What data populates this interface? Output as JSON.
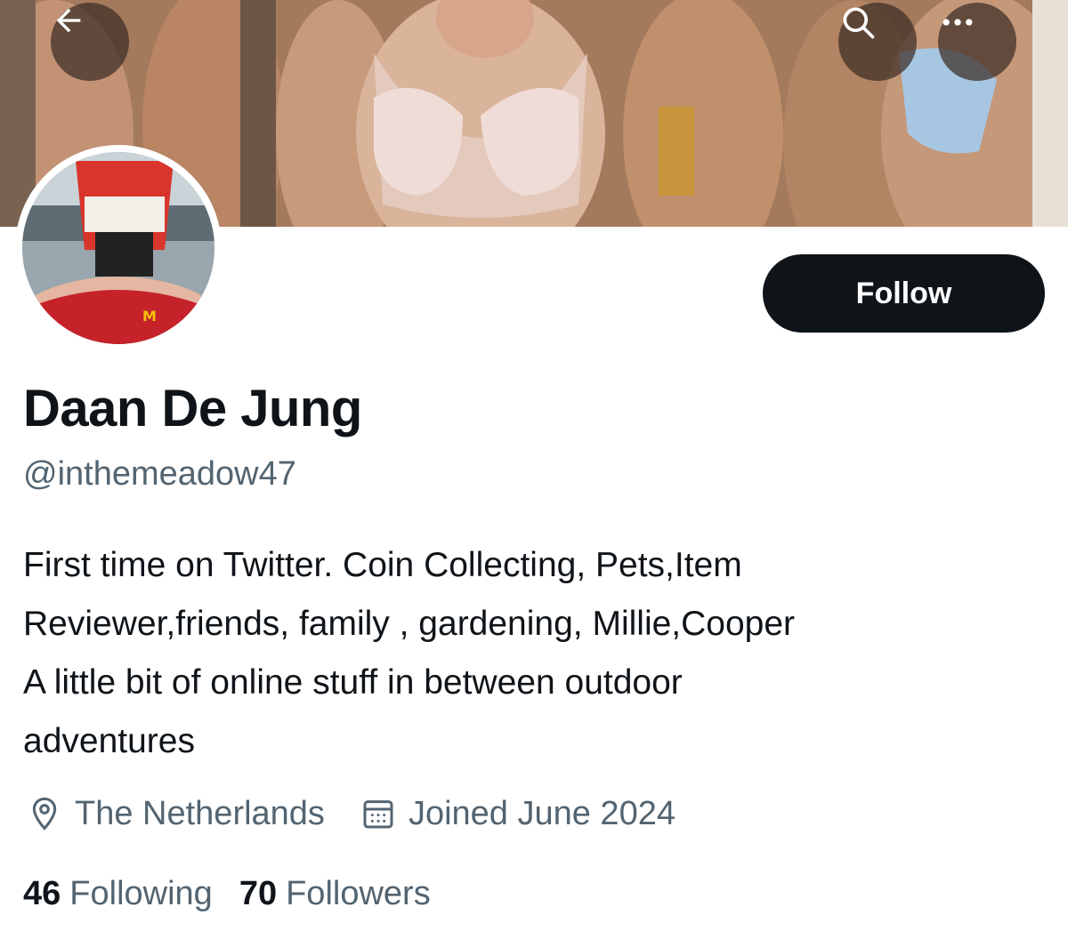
{
  "header": {
    "back_icon": "arrow-left-icon",
    "search_icon": "search-icon",
    "more_icon": "more-horizontal-icon"
  },
  "profile": {
    "display_name": "Daan De Jung",
    "handle": "@inthemeadow47",
    "follow_label": "Follow",
    "bio_lines": [
      "First time on Twitter. Coin Collecting, Pets,Item",
      "Reviewer,friends, family , gardening, Millie,Cooper",
      "A little bit of online stuff in between outdoor",
      "adventures"
    ],
    "location": "The Netherlands",
    "joined": "Joined June 2024",
    "following_count": "46",
    "following_label": "Following",
    "followers_count": "70",
    "followers_label": "Followers"
  },
  "colors": {
    "follow_bg": "#0f1419",
    "secondary_text": "#536471",
    "overlay_button": "#3c2d26"
  }
}
